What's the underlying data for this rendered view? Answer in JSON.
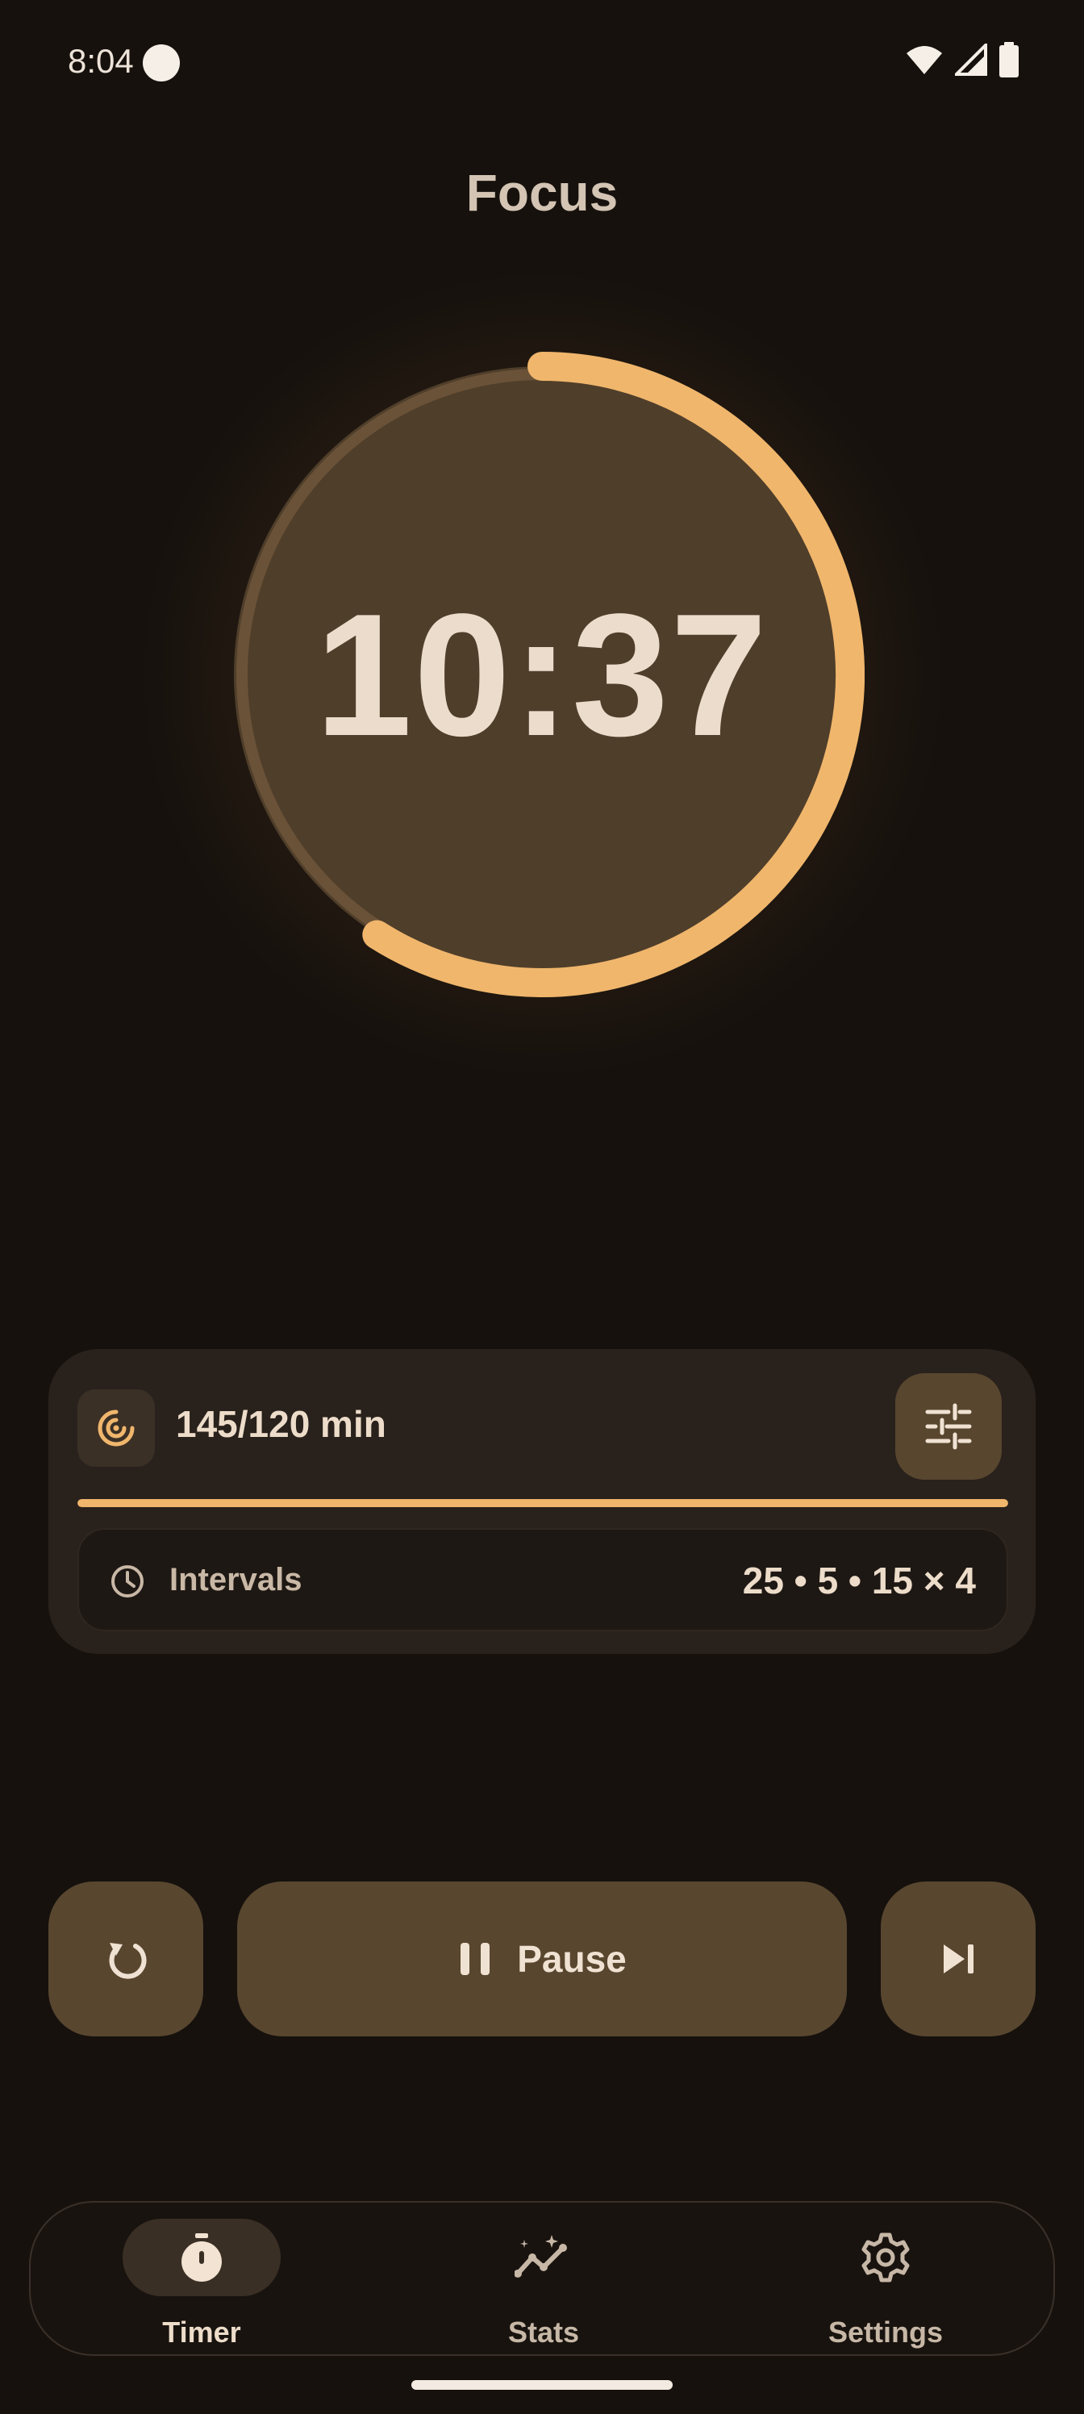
{
  "status_bar": {
    "time": "8:04"
  },
  "header": {
    "title": "Focus"
  },
  "timer": {
    "display": "10:37",
    "progress": 0.59,
    "colors": {
      "arc": "#f0b66c",
      "track": "#6a5238",
      "fill": "#4f3e2a"
    }
  },
  "goal_card": {
    "icon": "target-icon",
    "progress_text": "145/120 min",
    "progress": 1.0,
    "tune_icon": "tune-sliders-icon",
    "intervals": {
      "icon": "clock-icon",
      "label": "Intervals",
      "value": "25 • 5 • 15 × 4"
    }
  },
  "controls": {
    "reset_icon": "reset-icon",
    "pause_icon": "pause-icon",
    "pause_label": "Pause",
    "skip_icon": "skip-next-icon"
  },
  "bottom_nav": {
    "items": [
      {
        "label": "Timer",
        "icon": "stopwatch-icon",
        "active": true
      },
      {
        "label": "Stats",
        "icon": "stats-icon",
        "active": false
      },
      {
        "label": "Settings",
        "icon": "gear-icon",
        "active": false
      }
    ]
  },
  "colors": {
    "background": "#16110d",
    "accent": "#f0b66c",
    "button": "#58462f",
    "card": "#29211c"
  }
}
